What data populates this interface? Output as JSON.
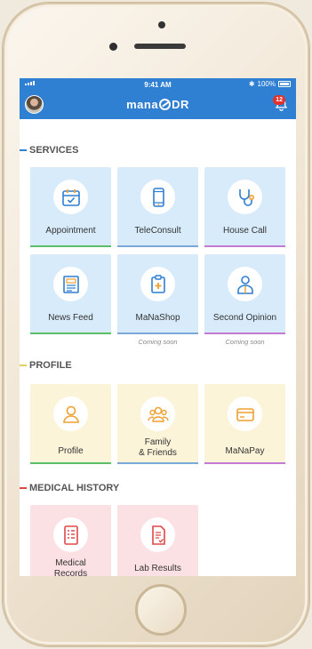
{
  "status_bar": {
    "time": "9:41 AM",
    "battery": "100%"
  },
  "app_bar": {
    "logo_left": "mana",
    "logo_right": "DR",
    "notification_count": "12"
  },
  "sections": {
    "services": {
      "title": "SERVICES",
      "accent": "#2f7fd2",
      "tiles": [
        {
          "label": "Appointment",
          "icon": "calendar-icon",
          "underline": "#5bbf6a"
        },
        {
          "label": "TeleConsult",
          "icon": "phone-icon",
          "underline": "#7aa8d8"
        },
        {
          "label": "House Call",
          "icon": "stethoscope-icon",
          "underline": "#c47ad1"
        },
        {
          "label": "News Feed",
          "icon": "news-icon",
          "underline": "#5bbf6a"
        },
        {
          "label": "MaNaShop",
          "icon": "clipboard-plus-icon",
          "underline": "#7aa8d8",
          "note": "Coming soon"
        },
        {
          "label": "Second Opinion",
          "icon": "doctor-icon",
          "underline": "#c47ad1",
          "note": "Coming soon"
        }
      ]
    },
    "profile": {
      "title": "PROFILE",
      "accent": "#e8cf5a",
      "tiles": [
        {
          "label": "Profile",
          "icon": "person-icon",
          "underline": "#5bbf6a"
        },
        {
          "label": "Family\n& Friends",
          "label_line1": "Family",
          "label_line2": "& Friends",
          "icon": "group-icon",
          "underline": "#7aa8d8"
        },
        {
          "label": "MaNaPay",
          "icon": "card-icon",
          "underline": "#c47ad1"
        }
      ]
    },
    "medical_history": {
      "title": "MEDICAL HISTORY",
      "accent": "#e04848",
      "tiles": [
        {
          "label_line1": "Medical",
          "label_line2": "Records",
          "icon": "records-icon",
          "underline": "#5bbf6a"
        },
        {
          "label": "Lab Results",
          "icon": "lab-report-icon",
          "underline": "#7aa8d8"
        }
      ]
    }
  }
}
